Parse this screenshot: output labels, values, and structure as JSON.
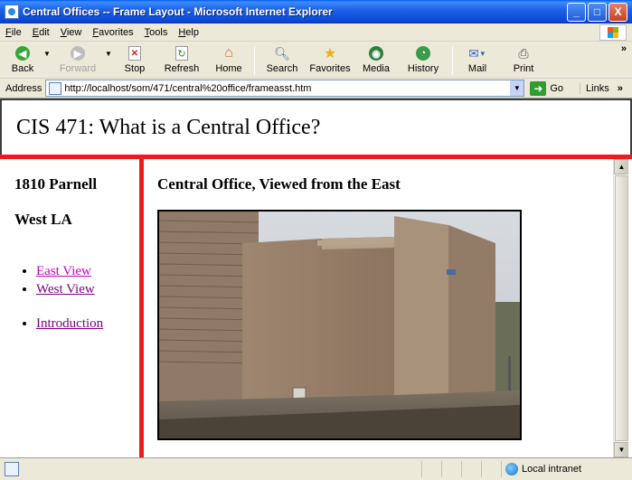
{
  "window": {
    "title": "Central Offices -- Frame Layout - Microsoft Internet Explorer",
    "minimize": "_",
    "maximize": "□",
    "close": "X"
  },
  "menu": [
    {
      "first": "F",
      "rest": "ile"
    },
    {
      "first": "E",
      "rest": "dit"
    },
    {
      "first": "V",
      "rest": "iew"
    },
    {
      "first": "F",
      "rest": "avorites"
    },
    {
      "first": "T",
      "rest": "ools"
    },
    {
      "first": "H",
      "rest": "elp"
    }
  ],
  "toolbar": {
    "back": "Back",
    "forward": "Forward",
    "stop": "Stop",
    "refresh": "Refresh",
    "home": "Home",
    "search": "Search",
    "favorites": "Favorites",
    "media": "Media",
    "history": "History",
    "mail": "Mail",
    "print": "Print",
    "more": "»"
  },
  "address": {
    "label": "Address",
    "url": "http://localhost/som/471/central%20office/frameasst.htm",
    "go": "Go",
    "links": "Links",
    "more": "»"
  },
  "page": {
    "heading": "CIS 471: What is a Central Office?",
    "left": {
      "street": "1810 Parnell",
      "area": "West LA",
      "links": [
        "East View",
        "West View"
      ],
      "intro": "Introduction"
    },
    "main": {
      "heading": "Central Office, Viewed from the East"
    }
  },
  "status": {
    "zone": "Local intranet"
  },
  "colors": {
    "frame_border": "#ee1b1b",
    "visited_link": "#800080",
    "active_link": "#cc00cc"
  }
}
